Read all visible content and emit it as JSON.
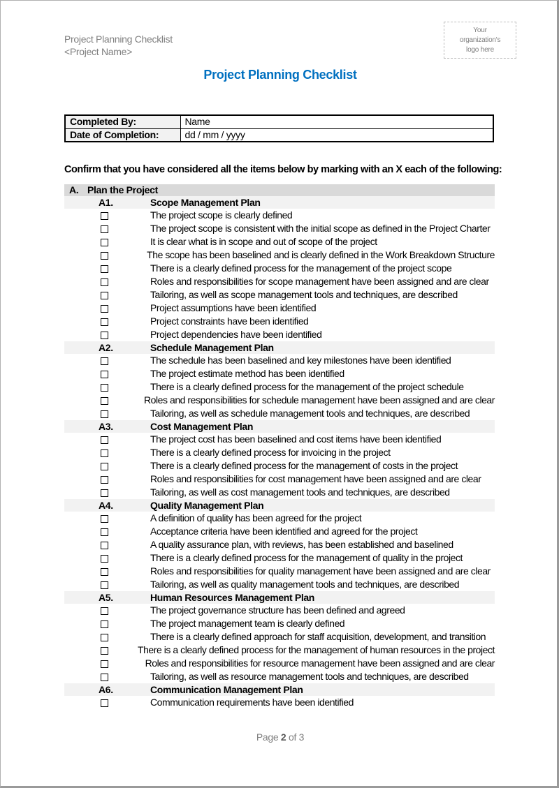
{
  "header": {
    "doc_name": "Project Planning Checklist",
    "project_name": "<Project Name>",
    "logo_placeholder": [
      "Your",
      "organization's",
      "logo here"
    ]
  },
  "title": "Project Planning Checklist",
  "info": {
    "completed_by_label": "Completed By:",
    "completed_by_value": "Name",
    "date_label": "Date of Completion:",
    "date_value": "dd / mm / yyyy"
  },
  "instruction": "Confirm that you have considered all the items below by marking with an X each of the following:",
  "section": {
    "letter": "A.",
    "title": "Plan the Project",
    "subsections": [
      {
        "num": "A1.",
        "title": "Scope Management Plan",
        "items": [
          "The project scope is clearly defined",
          "The project scope is consistent with the initial scope as defined in the Project Charter",
          "It is clear what is in scope and out of scope of the project",
          "The scope has been baselined and is clearly defined in the Work Breakdown Structure",
          "There is a clearly defined process for the management of the project scope",
          "Roles and responsibilities for scope management have been assigned and are clear",
          "Tailoring, as well as scope management tools and techniques, are described",
          "Project assumptions have been identified",
          "Project constraints have been identified",
          "Project dependencies have been identified"
        ]
      },
      {
        "num": "A2.",
        "title": "Schedule Management Plan",
        "items": [
          "The schedule has been baselined and key milestones have been identified",
          "The project estimate method has been identified",
          "There is a clearly defined process for the management of the project schedule",
          "Roles and responsibilities for schedule management have been assigned and are clear",
          "Tailoring, as well as schedule management tools and techniques, are described"
        ]
      },
      {
        "num": "A3.",
        "title": "Cost Management Plan",
        "items": [
          "The project cost has been baselined and cost items have been identified",
          "There is a clearly defined process for invoicing in the project",
          "There is a clearly defined process for the management of costs in the project",
          "Roles and responsibilities for cost management have been assigned and are clear",
          "Tailoring, as well as cost management tools and techniques, are described"
        ]
      },
      {
        "num": "A4.",
        "title": "Quality Management Plan",
        "items": [
          "A definition of quality has been agreed for the project",
          "Acceptance criteria have been identified and agreed for the project",
          "A quality assurance plan, with reviews, has been established and baselined",
          "There is a clearly defined process for the management of quality in the project",
          "Roles and responsibilities for quality management have been assigned and are clear",
          "Tailoring, as well as quality management tools and techniques, are described"
        ]
      },
      {
        "num": "A5.",
        "title": "Human Resources Management Plan",
        "items": [
          "The project governance structure has been defined and agreed",
          "The project management team is clearly defined",
          "There is a clearly defined approach for staff acquisition, development, and transition",
          "There is a clearly defined process for the management of human resources in the project",
          "Roles and responsibilities for resource management have been assigned and are clear",
          "Tailoring, as well as resource management tools and techniques, are described"
        ]
      },
      {
        "num": "A6.",
        "title": "Communication Management Plan",
        "items": [
          "Communication requirements have been identified"
        ]
      }
    ]
  },
  "footer": {
    "prefix": "Page ",
    "current": "2",
    "middle": " of ",
    "total": "3"
  },
  "colors": {
    "title": "#0070c0",
    "header_text": "#7f7f7f",
    "section_bg": "#d9d9d9",
    "subsection_bg": "#f2f2f2"
  }
}
